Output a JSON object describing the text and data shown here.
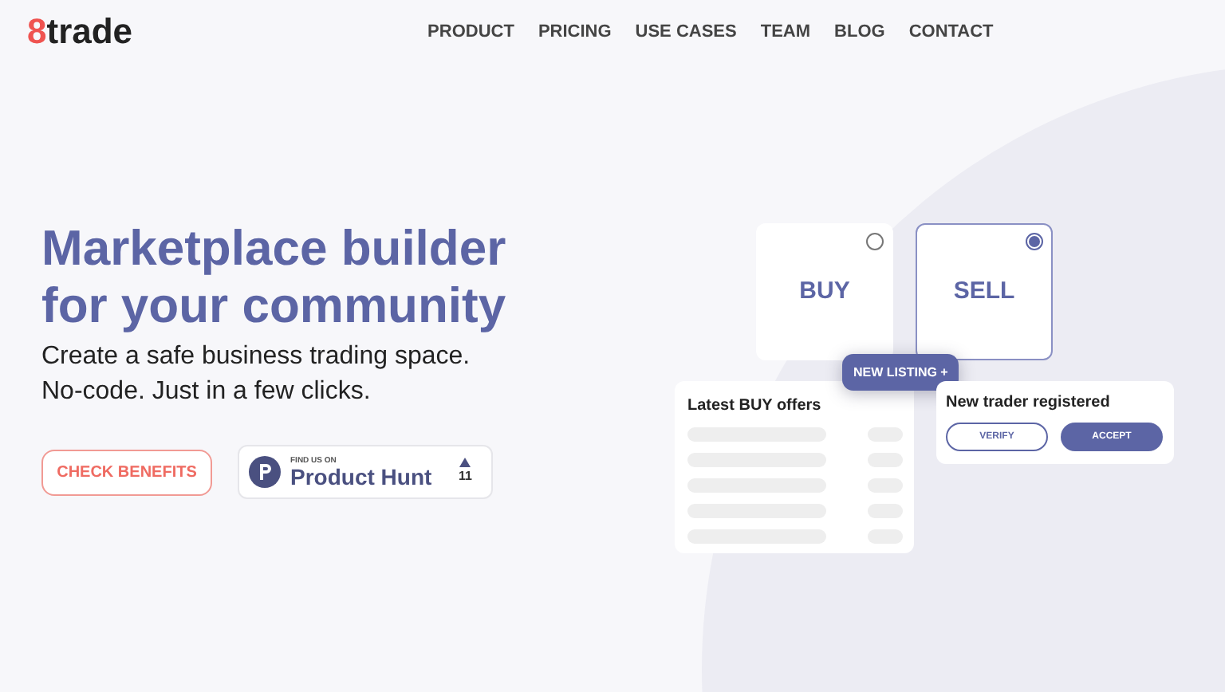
{
  "logo": {
    "mark": "8",
    "text": "trade"
  },
  "nav": [
    "PRODUCT",
    "PRICING",
    "USE CASES",
    "TEAM",
    "BLOG",
    "CONTACT"
  ],
  "hero": {
    "title_lines": [
      "Marketplace builder",
      "for your community"
    ],
    "subtitle_lines": [
      "Create a safe business trading space.",
      "No-code. Just in a few clicks."
    ]
  },
  "cta": {
    "label": "CHECK BENEFITS"
  },
  "product_hunt": {
    "caption": "FIND US ON",
    "name": "Product Hunt",
    "votes": "11"
  },
  "illustration": {
    "options": [
      {
        "label": "BUY",
        "selected": false
      },
      {
        "label": "SELL",
        "selected": true
      }
    ],
    "new_listing": "NEW LISTING +",
    "offers": {
      "title": "Latest BUY offers"
    },
    "trader": {
      "title": "New trader registered",
      "buttons": [
        "VERIFY",
        "ACCEPT"
      ]
    }
  }
}
